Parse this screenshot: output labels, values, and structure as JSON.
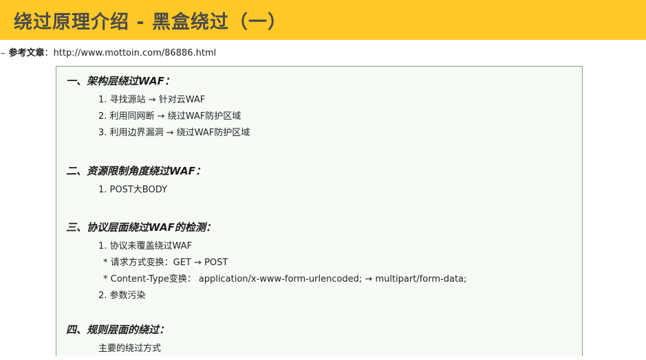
{
  "header": {
    "title": "绕过原理介绍 - 黑盒绕过（一）"
  },
  "reference": {
    "prefix": "~",
    "label": "参考文章",
    "separator": "：",
    "url": "http://www.mottoin.com/86886.html"
  },
  "sections": [
    {
      "heading": "一、架构层绕过WAF：",
      "items": [
        "1. 寻找源站 → 针对云WAF",
        "2. 利用同网断 → 绕过WAF防护区域",
        "3. 利用边界漏洞 → 绕过WAF防护区域"
      ]
    },
    {
      "heading": "二、资源限制角度绕过WAF：",
      "items": [
        "1. POST大BODY"
      ]
    },
    {
      "heading": "三、协议层面绕过WAF的检测：",
      "items": [
        "1. 协议未覆盖绕过WAF",
        "* 请求方式变换：GET → POST",
        "* Content-Type变换： application/x-www-form-urlencoded; → multipart/form-data;",
        "2. 参数污染"
      ]
    },
    {
      "heading": "四、规则层面的绕过：",
      "items": [
        "主要的绕过方式"
      ]
    }
  ],
  "colors": {
    "title_bar": "#ffc928",
    "title_text": "#4a4a4a",
    "box_background": "#f6fbf6",
    "box_border": "#7aa07a"
  }
}
